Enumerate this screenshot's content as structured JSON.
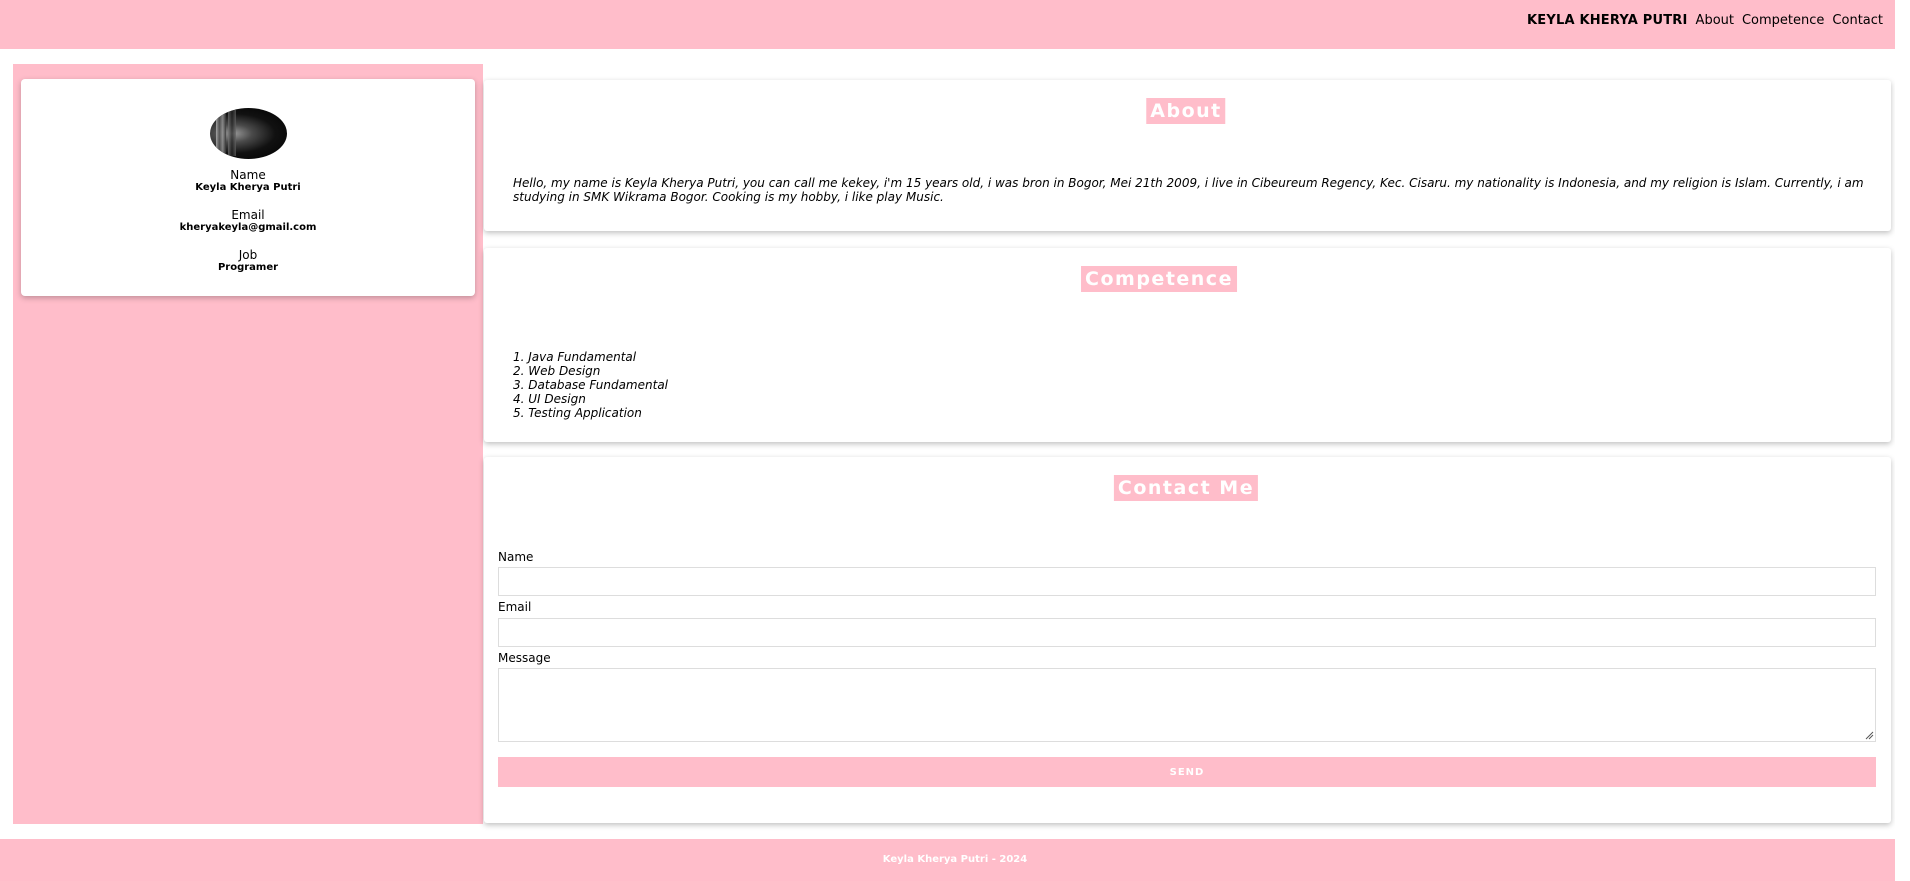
{
  "header": {
    "brand": "KEYLA KHERYA PUTRI",
    "nav": [
      "About",
      "Competence",
      "Contact"
    ]
  },
  "profile": {
    "avatar_icon": "profile-photo",
    "name_label": "Name",
    "name_value": "Keyla Kherya Putri",
    "email_label": "Email",
    "email_value": "kheryakeyla@gmail.com",
    "job_label": "Job",
    "job_value": "Programer"
  },
  "about": {
    "title": "About",
    "text": "Hello, my name is Keyla Kherya Putri, you can call me kekey, i'm 15 years old, i was bron in Bogor, Mei 21th 2009, i live in Cibeureum Regency, Kec. Cisaru. my nationality is Indonesia, and my religion is Islam. Currently, i am studying in SMK Wikrama Bogor. Cooking is my hobby, i like play Music."
  },
  "competence": {
    "title": "Competence",
    "items": [
      "1. Java Fundamental",
      "2. Web Design",
      "3. Database Fundamental",
      "4. UI Design",
      "5. Testing Application"
    ]
  },
  "contact": {
    "title": "Contact Me",
    "name_label": "Name",
    "name_value": "",
    "email_label": "Email",
    "email_value": "",
    "message_label": "Message",
    "message_value": "",
    "send_label": "SEND"
  },
  "footer": {
    "text": "Keyla Kherya Putri - 2024"
  },
  "colors": {
    "accent": "#ffbdca"
  }
}
